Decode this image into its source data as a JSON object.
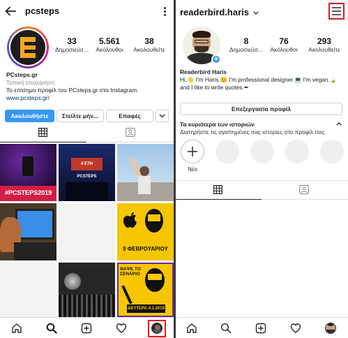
{
  "left": {
    "username": "pcsteps",
    "icons": {
      "back": "arrow-left-icon",
      "menu": "more-vertical-icon"
    },
    "stats": [
      {
        "value": "33",
        "label": "Δημοσιεύσ..."
      },
      {
        "value": "5.561",
        "label": "Ακόλουθοι"
      },
      {
        "value": "38",
        "label": "Ακολουθείτε"
      }
    ],
    "name": "PCsteps.gr",
    "category": "Τοπική επιχείρηση",
    "bio": "Το επίσημο προφίλ του PCsteps.gr στο Instagram.",
    "website": "www.pcsteps.gr/",
    "buttons": {
      "follow": "Ακολουθήστε",
      "message": "Στείλτε μήν...",
      "contact": "Επαφές"
    },
    "posts": [
      {
        "caption": "#PCSTEPS2019"
      },
      {
        "caption": "4 ΕΤΗ PCSTEPS"
      },
      {
        "caption": ""
      },
      {
        "caption": ""
      },
      {
        "caption": ""
      },
      {
        "caption": "9 ΦΕΒΡΟΥΑΡΙΟΥ"
      },
      {
        "caption": ""
      },
      {
        "caption": ""
      },
      {
        "caption": "ΘΑΨΕ ΤΟ ΣΕΝΑΡΙΟ",
        "subcaption": "ΔΕΥΤΕΡΑ 4.1.2019"
      }
    ]
  },
  "right": {
    "username": "readerbird.haris",
    "stats": [
      {
        "value": "8",
        "label": "Δημοσιεύσ..."
      },
      {
        "value": "76",
        "label": "Ακόλουθοι"
      },
      {
        "value": "293",
        "label": "Ακολουθείτε"
      }
    ],
    "name": "Readerbird Haris",
    "bio_line1": "Hi,👋 I'm Haris.😊 I'm professional designer.💻 I'm vegan.🍃",
    "bio_line2": "and I like to write quotes.✒",
    "edit_button": "Επεξεργασία προφίλ",
    "highlights_title": "Τα κυριότερα των ιστοριών",
    "highlights_sub": "Διατηρήστε τις αγαπημένες σας ιστορίες στο προφίλ σας",
    "new_label": "Νέο"
  },
  "colors": {
    "accent": "#3897f0",
    "highlight": "#e21b1b",
    "pcsteps_orange": "#f5a623",
    "yellow": "#f7c600"
  }
}
